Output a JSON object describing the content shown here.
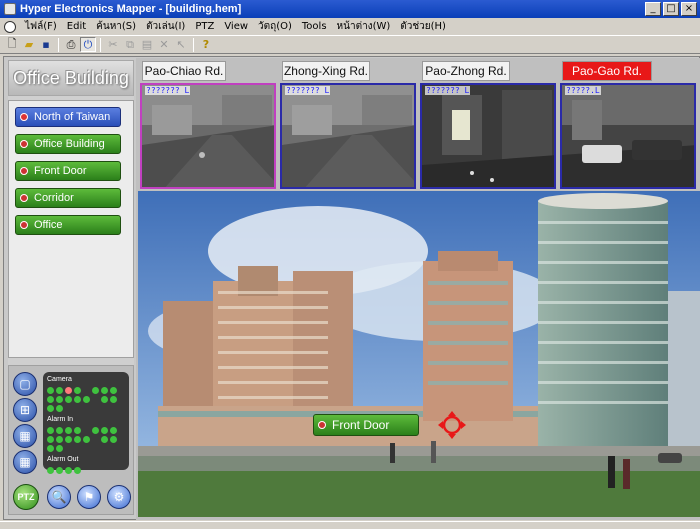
{
  "window": {
    "title": "Hyper Electronics Mapper - [building.hem]"
  },
  "menu": [
    "ไฟล์(F)",
    "Edit",
    "ค้นหา(S)",
    "ตัวเล่น(I)",
    "PTZ",
    "View",
    "วัตถุ(O)",
    "Tools",
    "หน้าต่าง(W)",
    "ตัวช่วย(H)"
  ],
  "toolbar": {
    "icons": [
      "new-file-icon",
      "open-folder-icon",
      "save-icon",
      "print-icon",
      "power-icon",
      "cut-icon",
      "copy-icon",
      "paste-icon",
      "delete-icon",
      "pointer-icon",
      "help-icon"
    ]
  },
  "left_panel": {
    "title": "Office Building",
    "nav": [
      {
        "label": "North of Taiwan",
        "selected": true
      },
      {
        "label": "Office Building",
        "selected": false
      },
      {
        "label": "Front Door",
        "selected": false
      },
      {
        "label": "Corridor",
        "selected": false
      },
      {
        "label": "Office",
        "selected": false
      }
    ],
    "status": {
      "camera_label": "Camera",
      "alarm_in_label": "Alarm In",
      "alarm_out_label": "Alarm Out"
    },
    "ptz_label": "PTZ"
  },
  "cameras": [
    {
      "name": "Pao-Chiao Rd.",
      "overlay": "??????? L",
      "alarm": false
    },
    {
      "name": "Zhong-Xing Rd.",
      "overlay": "??????? L",
      "alarm": false
    },
    {
      "name": "Pao-Zhong Rd.",
      "overlay": "??????? L",
      "alarm": false
    },
    {
      "name": "Pao-Gao Rd.",
      "overlay": "?????.L",
      "alarm": true
    }
  ],
  "scene": {
    "hotspot_label": "Front Door"
  },
  "colors": {
    "nav_green": "#2b7f1a",
    "nav_selected_blue": "#2a4fb8",
    "alarm_red": "#e81818"
  }
}
